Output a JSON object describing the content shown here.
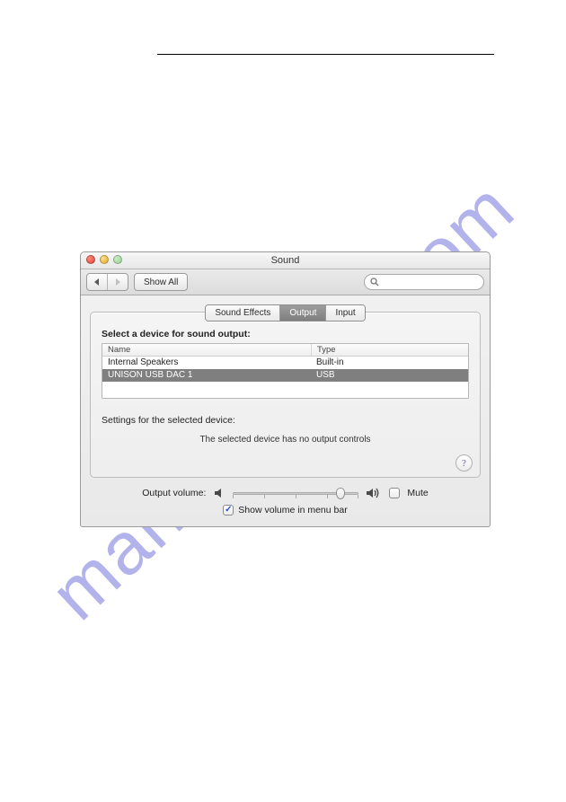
{
  "window": {
    "title": "Sound",
    "toolbar": {
      "show_all": "Show All"
    },
    "tabs": {
      "sound_effects": "Sound Effects",
      "output": "Output",
      "input": "Input"
    },
    "output": {
      "select_label": "Select a device for sound output:",
      "columns": {
        "name": "Name",
        "type": "Type"
      },
      "devices": [
        {
          "name": "Internal Speakers",
          "type": "Built-in"
        },
        {
          "name": "UNISON USB DAC 1",
          "type": "USB"
        }
      ],
      "settings_label": "Settings for the selected device:",
      "no_controls": "The selected device has no output controls"
    },
    "volume": {
      "label": "Output volume:",
      "mute": "Mute",
      "show_menu": "Show volume in menu bar",
      "value": 0.82
    },
    "help": "?"
  },
  "watermark": "manualshive.com"
}
